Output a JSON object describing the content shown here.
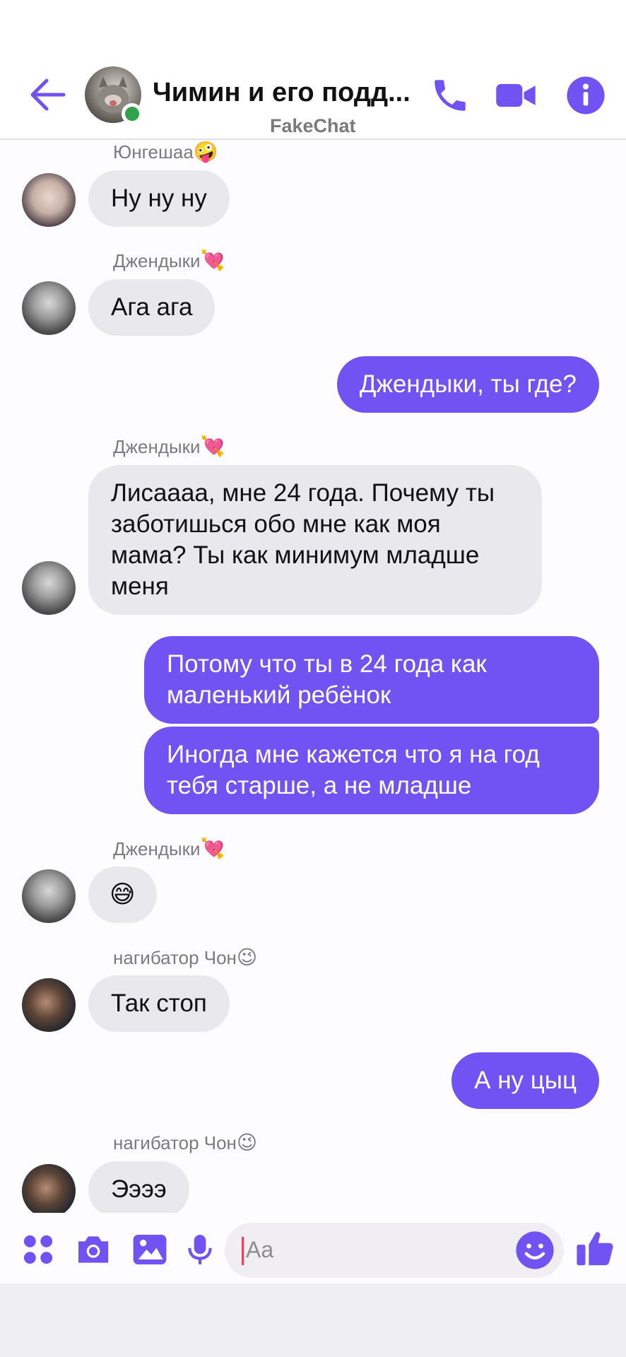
{
  "header": {
    "title": "Чимин и его подд...",
    "subtitle": "FakeChat",
    "back_icon": "arrow-left-icon",
    "call_icon": "phone-icon",
    "video_icon": "video-camera-icon",
    "info_icon": "info-icon",
    "accent_color": "#7152f3"
  },
  "messages": [
    {
      "type": "incoming",
      "sender": "Юнгешаа",
      "sender_emoji": "🤪",
      "text": "Ну ну ну"
    },
    {
      "type": "incoming",
      "sender": "Джендыки",
      "sender_emoji": "💘",
      "text": "Ага ага"
    },
    {
      "type": "outgoing",
      "text": "Джендыки, ты где?"
    },
    {
      "type": "incoming",
      "sender": "Джендыки",
      "sender_emoji": "💘",
      "text": "Лисаааа, мне 24 года. Почему ты заботишься обо мне как моя мама? Ты как минимум младше меня"
    },
    {
      "type": "outgoing",
      "text": "Потому что ты в 24 года как маленький ребёнок"
    },
    {
      "type": "outgoing",
      "text": "Иногда мне кажется что я на год тебя старше,  а не младше"
    },
    {
      "type": "incoming",
      "sender": "Джендыки",
      "sender_emoji": "💘",
      "text": "😅"
    },
    {
      "type": "incoming",
      "sender": "нагибатор Чон",
      "sender_emoji": "😉",
      "text": "Так стоп"
    },
    {
      "type": "outgoing",
      "text": "А ну цыц"
    },
    {
      "type": "incoming",
      "sender": "нагибатор Чон",
      "sender_emoji": "😉",
      "text": "Ээээ"
    }
  ],
  "composer": {
    "placeholder": "Aa",
    "icons": [
      "apps-icon",
      "camera-icon",
      "image-icon",
      "microphone-icon",
      "smiley-icon",
      "thumbs-up-icon"
    ]
  },
  "colors": {
    "outgoing_bubble": "#7152f3",
    "incoming_bubble": "#e9e8ec",
    "online": "#31a24c"
  }
}
